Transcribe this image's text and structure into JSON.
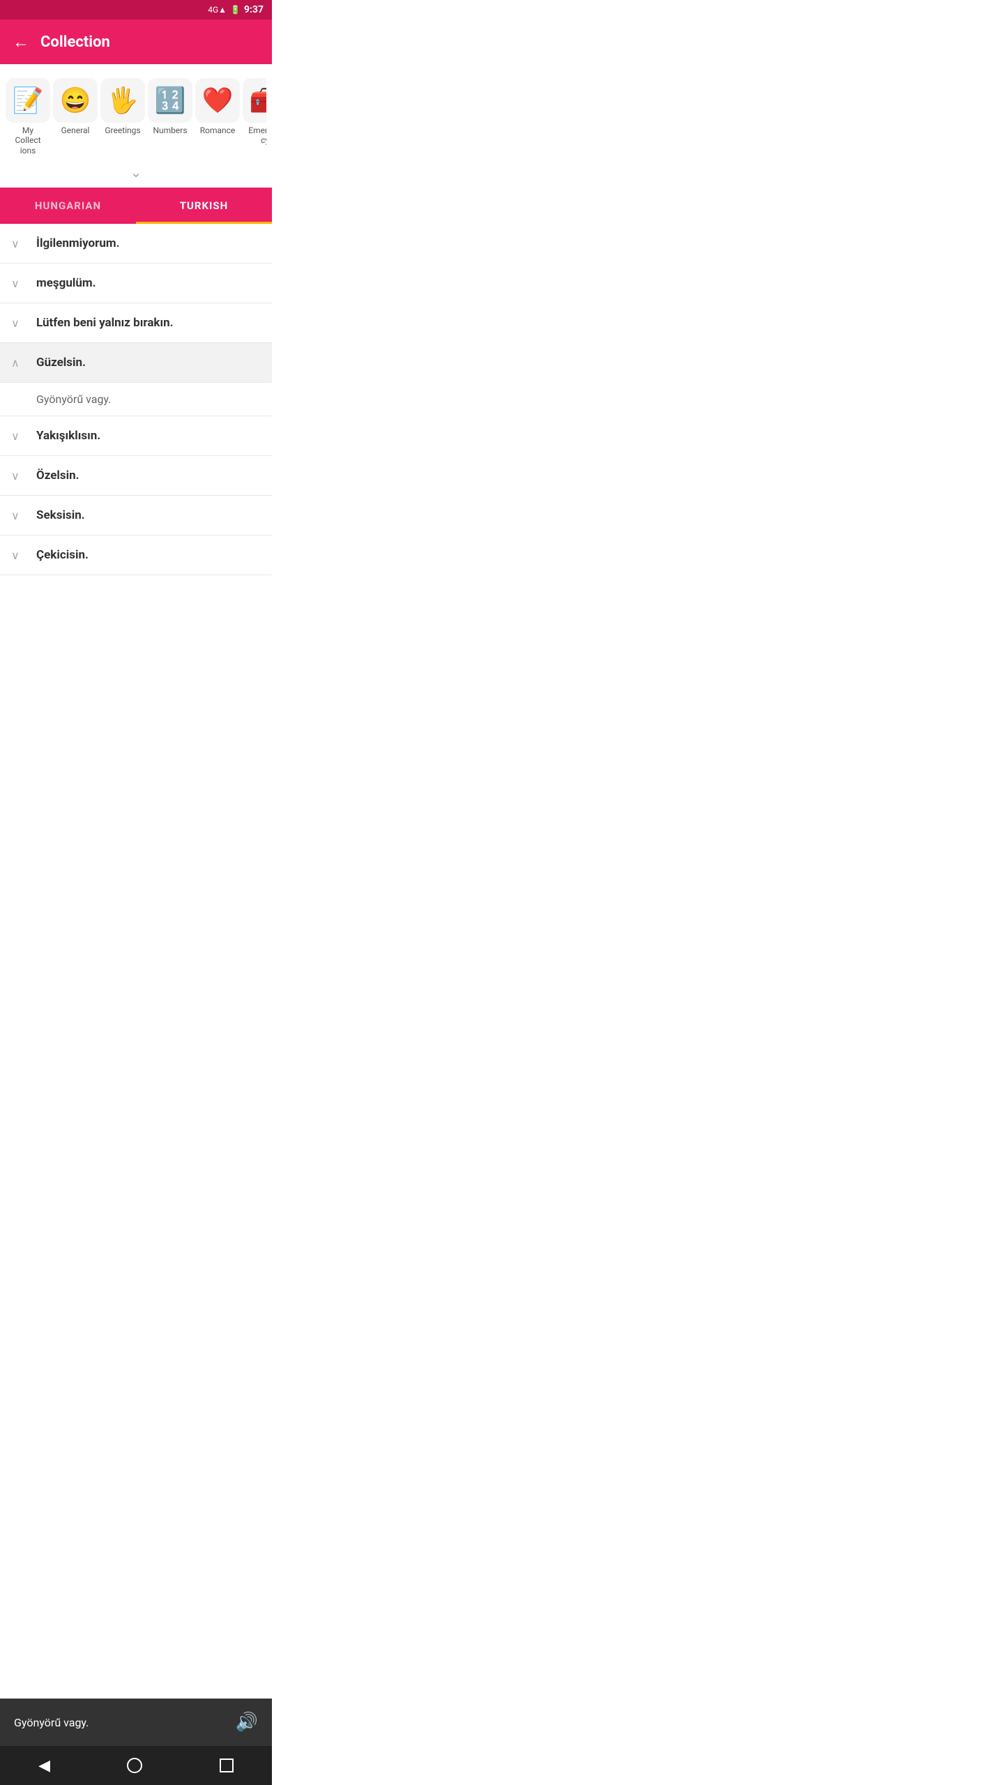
{
  "statusBar": {
    "time": "9:37",
    "network": "4G"
  },
  "topBar": {
    "title": "Collection",
    "backLabel": "←"
  },
  "categories": [
    {
      "id": "my-collections",
      "emoji": "📝",
      "label": "My Collect ions"
    },
    {
      "id": "general",
      "emoji": "😄",
      "label": "General"
    },
    {
      "id": "greetings",
      "emoji": "🖐",
      "label": "Greetings"
    },
    {
      "id": "numbers",
      "emoji": "🔢",
      "label": "Numbers"
    },
    {
      "id": "romance",
      "emoji": "❤️",
      "label": "Romance"
    },
    {
      "id": "emergency",
      "emoji": "🧰",
      "label": "Emergen cy"
    }
  ],
  "tabs": [
    {
      "id": "hungarian",
      "label": "HUNGARIAN",
      "active": false
    },
    {
      "id": "turkish",
      "label": "TURKISH",
      "active": true
    }
  ],
  "phrases": [
    {
      "id": "p1",
      "text": "İlgilenmiyorum.",
      "expanded": false,
      "translation": null
    },
    {
      "id": "p2",
      "text": "meşgulüm.",
      "expanded": false,
      "translation": null
    },
    {
      "id": "p3",
      "text": "Lütfen beni yalnız bırakın.",
      "expanded": false,
      "translation": null
    },
    {
      "id": "p4",
      "text": "Güzelsin.",
      "expanded": true,
      "translation": "Gyönyörű vagy."
    },
    {
      "id": "p5",
      "text": "Yakışıklısın.",
      "expanded": false,
      "translation": null
    },
    {
      "id": "p6",
      "text": "Özelsin.",
      "expanded": false,
      "translation": null
    },
    {
      "id": "p7",
      "text": "Seksisin.",
      "expanded": false,
      "translation": null
    },
    {
      "id": "p8",
      "text": "Çekicisin.",
      "expanded": false,
      "translation": null
    }
  ],
  "audioBar": {
    "text": "Gyönyörű vagy.",
    "speakerLabel": "🔊"
  },
  "expandChevron": "∨",
  "colors": {
    "pink": "#e91e63",
    "darkPink": "#c0124d",
    "yellow": "#ffb300"
  }
}
